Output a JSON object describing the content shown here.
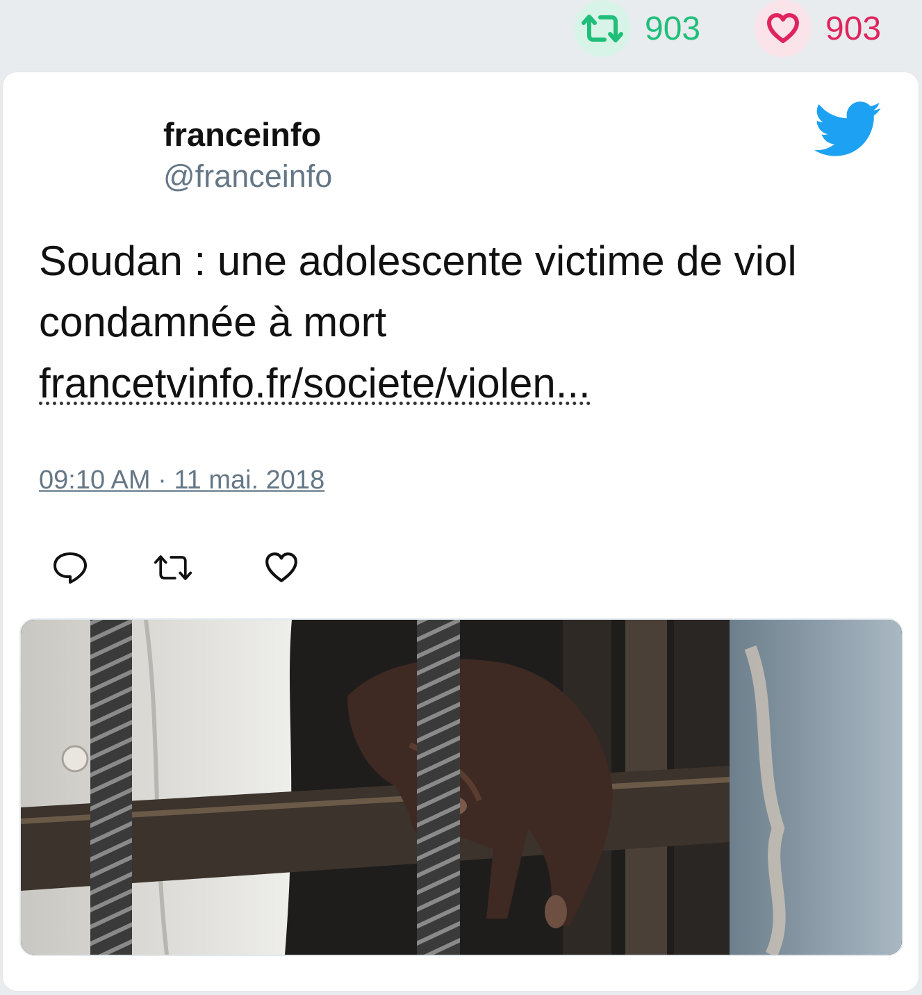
{
  "stats": {
    "retweet_count": "903",
    "like_count": "903",
    "retweet_color": "#1fbf7a",
    "like_color": "#e0245e"
  },
  "tweet": {
    "author_name": "franceinfo",
    "author_handle": "@franceinfo",
    "text": "Soudan : une adolescente victime de viol condamnée à mort",
    "link": "francetvinfo.fr/societe/violen...",
    "timestamp": "09:10 AM · 11 mai. 2018"
  },
  "icons": {
    "brand": "twitter-bird-icon",
    "stat_retweet": "retweet-icon",
    "stat_like": "heart-icon",
    "action_reply": "reply-icon",
    "action_retweet": "retweet-icon",
    "action_like": "heart-icon"
  },
  "brand_color": "#1da1f2"
}
